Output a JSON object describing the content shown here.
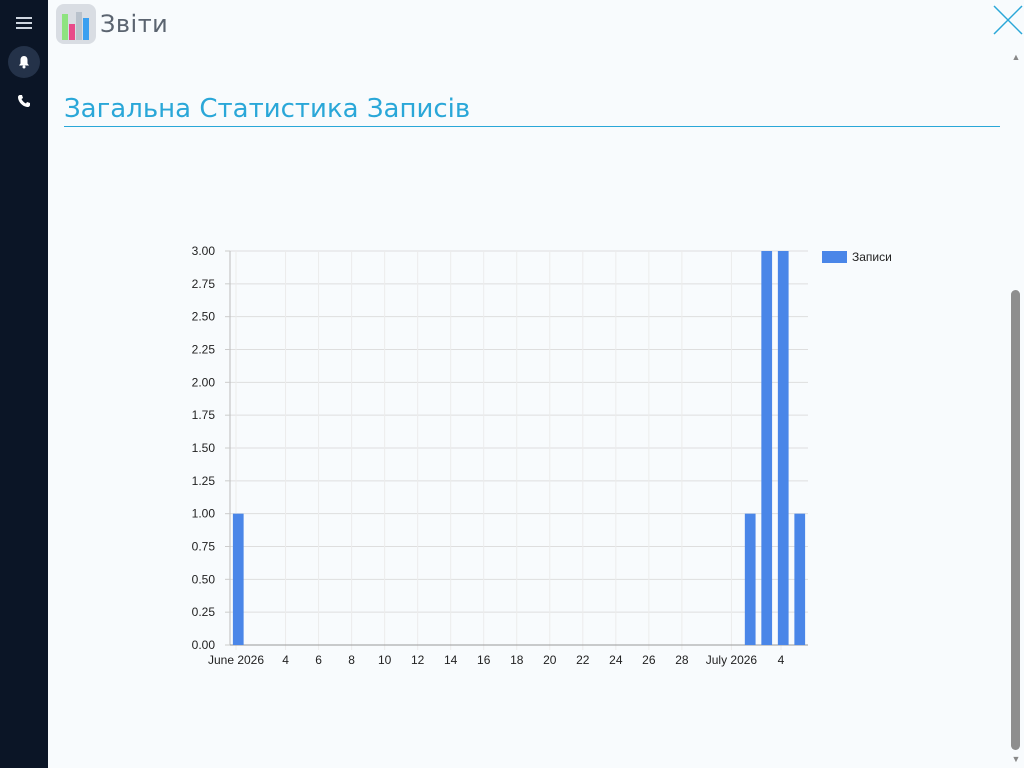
{
  "app": {
    "title": "Звіти"
  },
  "section": {
    "title": "Загальна Статистика Записів"
  },
  "icons": {
    "menu": "menu-icon",
    "notifications": "bell-icon",
    "phone": "phone-icon",
    "close": "close-icon",
    "app": "reports-chart-icon"
  },
  "colors": {
    "sidebar": "#0b1526",
    "accent": "#2aa7d8",
    "bar": "#4a86e8"
  },
  "chart_data": {
    "type": "bar",
    "title": "",
    "xlabel": "",
    "ylabel": "",
    "legend": {
      "position": "top-right",
      "entries": [
        "Записи"
      ]
    },
    "ylim": [
      0,
      3
    ],
    "yticks": [
      "0.00",
      "0.25",
      "0.50",
      "0.75",
      "1.00",
      "1.25",
      "1.50",
      "1.75",
      "2.00",
      "2.25",
      "2.50",
      "2.75",
      "3.00"
    ],
    "xrange": [
      "2026-06-01",
      "2026-07-05"
    ],
    "xticks": [
      {
        "date": "2026-06-01",
        "label": "June 2026"
      },
      {
        "date": "2026-06-04",
        "label": "4"
      },
      {
        "date": "2026-06-06",
        "label": "6"
      },
      {
        "date": "2026-06-08",
        "label": "8"
      },
      {
        "date": "2026-06-10",
        "label": "10"
      },
      {
        "date": "2026-06-12",
        "label": "12"
      },
      {
        "date": "2026-06-14",
        "label": "14"
      },
      {
        "date": "2026-06-16",
        "label": "16"
      },
      {
        "date": "2026-06-18",
        "label": "18"
      },
      {
        "date": "2026-06-20",
        "label": "20"
      },
      {
        "date": "2026-06-22",
        "label": "22"
      },
      {
        "date": "2026-06-24",
        "label": "24"
      },
      {
        "date": "2026-06-26",
        "label": "26"
      },
      {
        "date": "2026-06-28",
        "label": "28"
      },
      {
        "date": "2026-07-01",
        "label": "July 2026"
      },
      {
        "date": "2026-07-04",
        "label": "4"
      }
    ],
    "series": [
      {
        "name": "Записи",
        "points": [
          {
            "x": "2026-06-01",
            "y": 1
          },
          {
            "x": "2026-07-02",
            "y": 1
          },
          {
            "x": "2026-07-03",
            "y": 3
          },
          {
            "x": "2026-07-04",
            "y": 3
          },
          {
            "x": "2026-07-05",
            "y": 1
          }
        ]
      }
    ],
    "grid": true
  }
}
